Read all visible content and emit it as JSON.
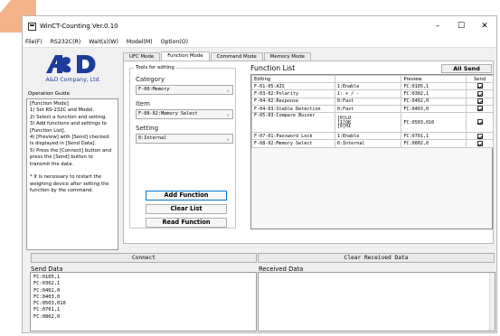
{
  "window": {
    "title": "WinCT-Counting Ver.0.10",
    "controls": {
      "minimize": "–",
      "maximize": "☐",
      "close": "✕"
    }
  },
  "menu": [
    "File(F)",
    "RS232C(R)",
    "Wait(s)(W)",
    "Model(M)",
    "Option(O)"
  ],
  "left": {
    "company": "A&D Company, Ltd.",
    "guide_title": "Operation Guide",
    "guide_text": "[Function Mode]\n1) Set RS-232C and Model.\n2) Select a function and setting.\n3) Add functions and settings to\n[Function List].\n4) [Preview] with [Send] checked\nis displayed in [Send Data].\n5) Press the [Connect] button and\npress the [Send] button to\ntransmit the data.\n\n* It is necessary to restart the\nweighing device after setting the\nfunction by the command."
  },
  "tabs": [
    {
      "label": "UFC Mode",
      "active": false
    },
    {
      "label": "Function Mode",
      "active": true
    },
    {
      "label": "Command Mode",
      "active": false
    },
    {
      "label": "Memory Mode",
      "active": false
    }
  ],
  "editor": {
    "legend": "Tools for editing",
    "category_label": "Category",
    "category_value": "F-00:Memory",
    "item_label": "Item",
    "item_value": "F-08-02:Memory Select",
    "setting_label": "Setting",
    "setting_value": "0:Internal",
    "add_button": "Add Function",
    "clear_button": "Clear List",
    "read_button": "Read Function"
  },
  "function_list": {
    "title": "Function List",
    "all_send": "All Send",
    "columns": [
      "Editing",
      "",
      "Preview",
      "Send"
    ],
    "rows": [
      {
        "editing": "F-01-05:AIS",
        "setting": "1:Enable",
        "preview": "FC:0105,1",
        "send": true
      },
      {
        "editing": "F-03-02:Polarity",
        "setting": "1: + / -",
        "preview": "FC:0302,1",
        "send": true
      },
      {
        "editing": "F-04-02:Response",
        "setting": "0:Fast",
        "preview": "FC:0402,0",
        "send": true
      },
      {
        "editing": "F-04-03:Stable Detection",
        "setting": "0:Fast",
        "preview": "FC:0403,0",
        "send": true
      },
      {
        "editing": "F-05-03:Compare Buzzer",
        "setting": [
          "[0]LO",
          "[1]OK",
          "[0]HI"
        ],
        "preview": "FC:0503,010",
        "send": true
      },
      {
        "editing": "F-07-01:Password Lock",
        "setting": "1:Enable",
        "preview": "FC:0701,1",
        "send": true
      },
      {
        "editing": "F-08-02:Memory Select",
        "setting": "0:Internal",
        "preview": "FC:0802,0",
        "send": true
      }
    ]
  },
  "bottom": {
    "connect": "Connect",
    "clear_received": "Clear Received Data",
    "send_title": "Send Data",
    "received_title": "Received Data",
    "send_lines": [
      "FC:0105,1",
      "FC:0302,1",
      "FC:0402,0",
      "FC:0403,0",
      "FC:0503,010",
      "FC:0701,1",
      "FC:0802,0"
    ]
  },
  "colors": {
    "accent": "#0078d7",
    "brand_blue": "#1e3c9a",
    "corner": "#f2b38a"
  }
}
